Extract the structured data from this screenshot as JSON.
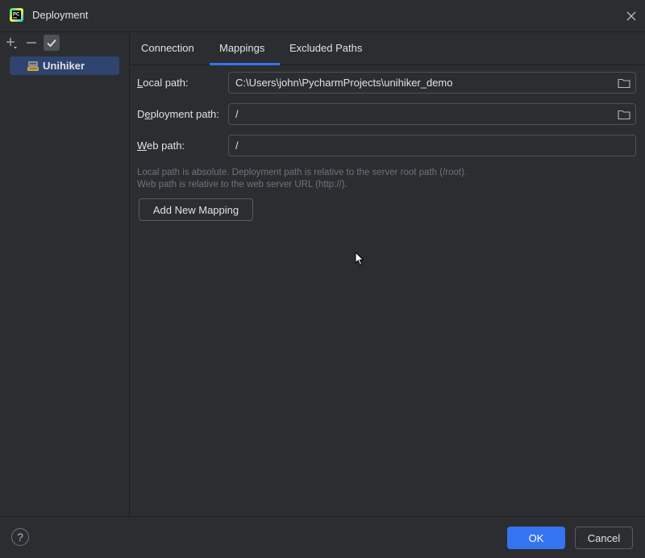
{
  "window": {
    "title": "Deployment",
    "app_icon": "pycharm-icon",
    "close_icon": "close-icon"
  },
  "servers": {
    "toolbar": {
      "add_icon": "plus-icon",
      "remove_icon": "minus-icon",
      "default_icon": "checkmark-icon"
    },
    "items": [
      {
        "label": "Unihiker",
        "icon": "sftp-server-icon",
        "selected": true
      }
    ]
  },
  "tabs": [
    {
      "label": "Connection",
      "active": false
    },
    {
      "label": "Mappings",
      "active": true
    },
    {
      "label": "Excluded Paths",
      "active": false
    }
  ],
  "mappings": {
    "local_path": {
      "label_mnemonic": "L",
      "label_rest": "ocal path:",
      "value": "C:\\Users\\john\\PycharmProjects\\unihiker_demo",
      "browse_icon": "folder-icon"
    },
    "deployment_path": {
      "label_pre": "D",
      "label_mnemonic": "e",
      "label_rest": "ployment path:",
      "value": "/",
      "browse_icon": "folder-icon"
    },
    "web_path": {
      "label_mnemonic": "W",
      "label_rest": "eb path:",
      "value": "/"
    },
    "hint_line1": "Local path is absolute. Deployment path is relative to the server root path (/root).",
    "hint_line2": "Web path is relative to the web server URL (http://).",
    "add_button": "Add New Mapping"
  },
  "footer": {
    "help_label": "?",
    "ok_label": "OK",
    "cancel_label": "Cancel"
  },
  "colors": {
    "background": "#2b2d30",
    "accent": "#3574f0",
    "selection": "#2e436e",
    "text": "#dfe1e5",
    "hint": "#6f737a"
  }
}
